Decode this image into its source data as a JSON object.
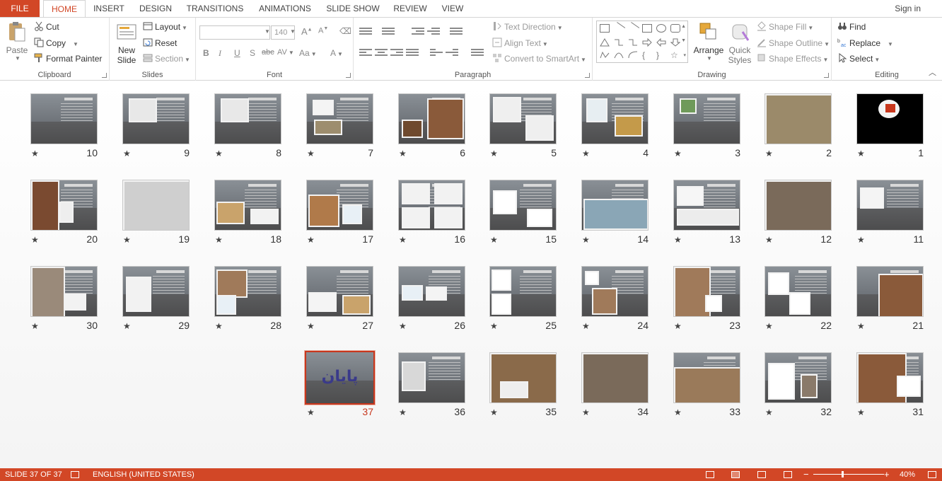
{
  "tabs": {
    "file": "FILE",
    "home": "HOME",
    "insert": "INSERT",
    "design": "DESIGN",
    "transitions": "TRANSITIONS",
    "animations": "ANIMATIONS",
    "slideshow": "SLIDE SHOW",
    "review": "REVIEW",
    "view": "VIEW",
    "signin": "Sign in"
  },
  "ribbon": {
    "clipboard": {
      "label": "Clipboard",
      "paste": "Paste",
      "cut": "Cut",
      "copy": "Copy",
      "format_painter": "Format Painter"
    },
    "slides": {
      "label": "Slides",
      "new_slide": "New Slide",
      "layout": "Layout",
      "reset": "Reset",
      "section": "Section"
    },
    "font": {
      "label": "Font",
      "font_name": "",
      "font_size": "140",
      "bold": "B",
      "italic": "I",
      "underline": "U",
      "shadow": "S",
      "strike": "abc",
      "spacing": "AV",
      "case": "Aa",
      "color": "A"
    },
    "paragraph": {
      "label": "Paragraph",
      "text_direction": "Text Direction",
      "align_text": "Align Text",
      "smartart": "Convert to SmartArt"
    },
    "drawing": {
      "label": "Drawing",
      "arrange": "Arrange",
      "quick_styles": "Quick Styles",
      "shape_fill": "Shape Fill",
      "shape_outline": "Shape Outline",
      "shape_effects": "Shape Effects"
    },
    "editing": {
      "label": "Editing",
      "find": "Find",
      "replace": "Replace",
      "select": "Select"
    }
  },
  "slides": [
    {
      "n": "10"
    },
    {
      "n": "9"
    },
    {
      "n": "8"
    },
    {
      "n": "7"
    },
    {
      "n": "6"
    },
    {
      "n": "5"
    },
    {
      "n": "4"
    },
    {
      "n": "3"
    },
    {
      "n": "2"
    },
    {
      "n": "1"
    },
    {
      "n": "20"
    },
    {
      "n": "19"
    },
    {
      "n": "18"
    },
    {
      "n": "17"
    },
    {
      "n": "16"
    },
    {
      "n": "15"
    },
    {
      "n": "14"
    },
    {
      "n": "13"
    },
    {
      "n": "12"
    },
    {
      "n": "11"
    },
    {
      "n": "30"
    },
    {
      "n": "29"
    },
    {
      "n": "28"
    },
    {
      "n": "27"
    },
    {
      "n": "26"
    },
    {
      "n": "25"
    },
    {
      "n": "24"
    },
    {
      "n": "23"
    },
    {
      "n": "22"
    },
    {
      "n": "21"
    },
    {
      "n": "37"
    },
    {
      "n": "36"
    },
    {
      "n": "35"
    },
    {
      "n": "34"
    },
    {
      "n": "33"
    },
    {
      "n": "32"
    },
    {
      "n": "31"
    }
  ],
  "selected_slide": "37",
  "slide_37_title": "پایان",
  "transition_marker": "★",
  "status": {
    "slide_info": "SLIDE 37 OF 37",
    "language": "ENGLISH (UNITED STATES)",
    "zoom": "40%",
    "zoom_minus": "−",
    "zoom_plus": "+"
  },
  "colors": {
    "accent": "#d24726",
    "selected": "#c8371d"
  }
}
